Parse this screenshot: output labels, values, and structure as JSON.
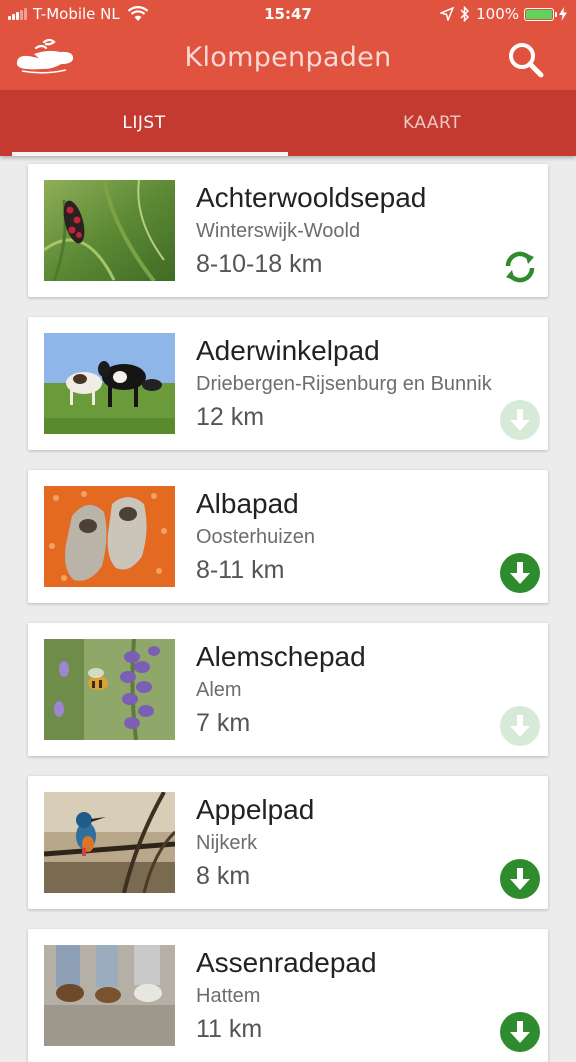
{
  "status_bar": {
    "carrier": "T-Mobile NL",
    "time": "15:47",
    "battery": "100%"
  },
  "app": {
    "title": "Klompenpaden"
  },
  "tabs": [
    {
      "label": "LIJST",
      "active": true
    },
    {
      "label": "KAART",
      "active": false
    }
  ],
  "colors": {
    "accent": "#e0533f",
    "tab_bar": "#c43a31",
    "download_green": "#2e8b2e",
    "download_disabled": "#d7ead7"
  },
  "routes": [
    {
      "name": "Achterwooldsepad",
      "location": "Winterswijk-Woold",
      "distance": "8-10-18 km",
      "status": "sync-icon",
      "image": "moth on grass"
    },
    {
      "name": "Aderwinkelpad",
      "location": "Driebergen-Rijsenburg en Bunnik",
      "distance": "12 km",
      "status": "download-disabled-icon",
      "image": "cows in meadow"
    },
    {
      "name": "Albapad",
      "location": "Oosterhuizen",
      "distance": "8-11 km",
      "status": "download-icon",
      "image": "wooden clogs"
    },
    {
      "name": "Alemschepad",
      "location": "Alem",
      "distance": "7 km",
      "status": "download-disabled-icon",
      "image": "bee on lavender"
    },
    {
      "name": "Appelpad",
      "location": "Nijkerk",
      "distance": "8 km",
      "status": "download-icon",
      "image": "kingfisher on branch"
    },
    {
      "name": "Assenradepad",
      "location": "Hattem",
      "distance": "11 km",
      "status": "download-icon",
      "image": "walkers feet"
    }
  ]
}
